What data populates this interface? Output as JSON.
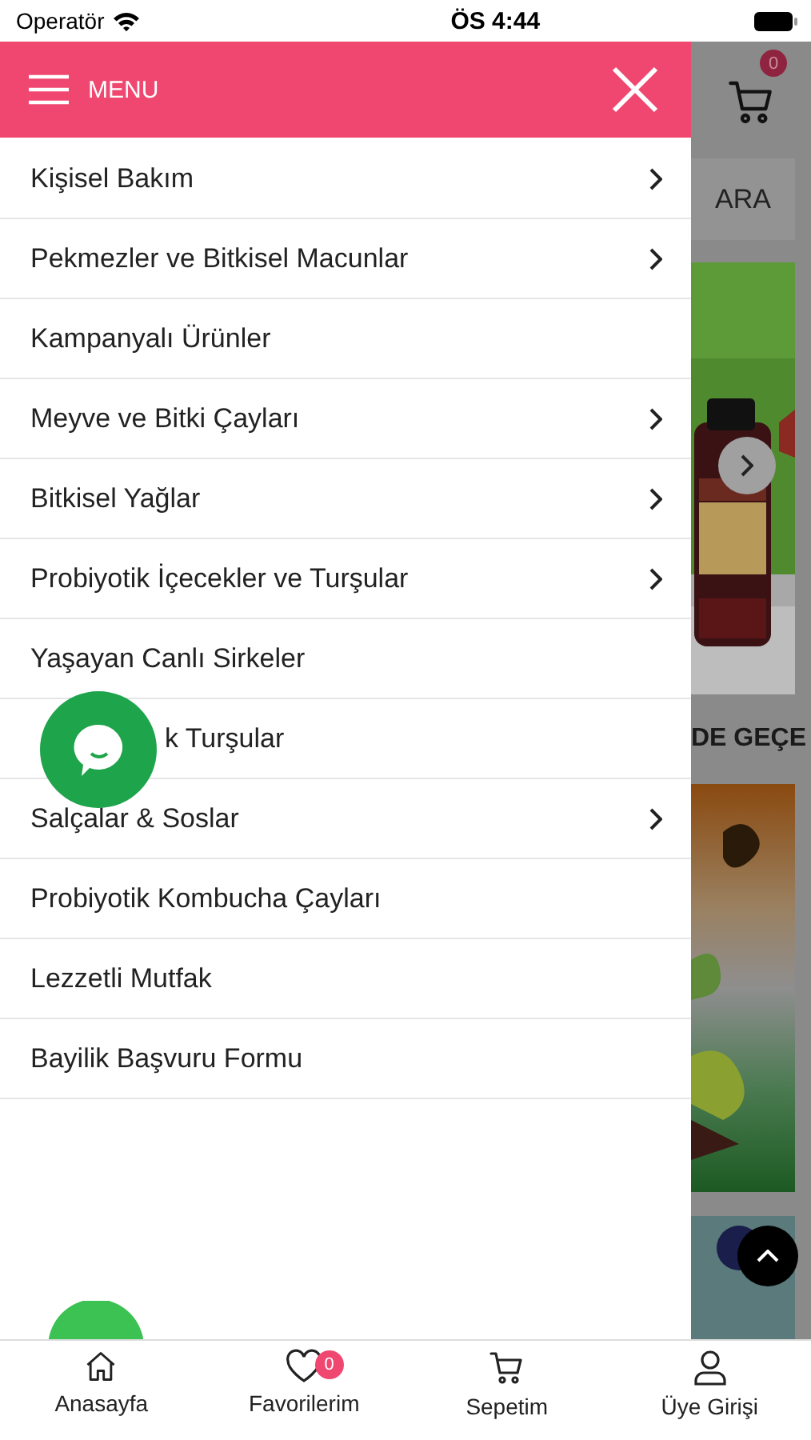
{
  "status_bar": {
    "carrier": "Operatör",
    "time": "ÖS 4:44"
  },
  "menu": {
    "title": "MENU",
    "items": [
      {
        "label": "Kişisel Bakım",
        "has_children": true
      },
      {
        "label": "Pekmezler ve Bitkisel Macunlar",
        "has_children": true
      },
      {
        "label": "Kampanyalı Ürünler",
        "has_children": false
      },
      {
        "label": "Meyve ve Bitki Çayları",
        "has_children": true
      },
      {
        "label": "Bitkisel Yağlar",
        "has_children": true
      },
      {
        "label": "Probiyotik İçecekler ve Turşular",
        "has_children": true
      },
      {
        "label": "Yaşayan Canlı Sirkeler",
        "has_children": false
      },
      {
        "label": "k Turşular",
        "has_children": false,
        "covered": true
      },
      {
        "label": "Salçalar & Soslar",
        "has_children": true
      },
      {
        "label": "Probiyotik Kombucha Çayları",
        "has_children": false
      },
      {
        "label": "Lezzetli Mutfak",
        "has_children": false
      },
      {
        "label": "Bayilik Başvuru Formu",
        "has_children": false
      }
    ]
  },
  "page_behind": {
    "cart_badge": "0",
    "search_button": "ARA",
    "section_heading": "DE GEÇE"
  },
  "bottom_nav": [
    {
      "kind": "home",
      "label": "Anasayfa"
    },
    {
      "kind": "favorites",
      "label": "Favorilerim",
      "badge": "0"
    },
    {
      "kind": "cart",
      "label": "Sepetim"
    },
    {
      "kind": "account",
      "label": "Üye Girişi"
    }
  ]
}
